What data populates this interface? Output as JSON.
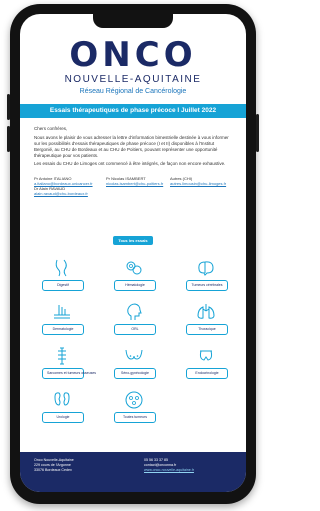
{
  "logo": {
    "word": "ONCO",
    "region": "NOUVELLE-AQUITAINE",
    "subtitle": "Réseau Régional de Cancérologie"
  },
  "banner": {
    "title": "Essais thérapeutiques de phase précoce I Juillet 2022"
  },
  "body": {
    "greeting": "Chers confrères,",
    "intro": "Nous avons le plaisir de vous adresser la lettre d'information bimestrielle destinée à vous informer sur les possibilités d'essais thérapeutiques de phase précoce (I et II) disponibles à l'Institut Bergonié, au CHU de Bordeaux et au CHU de Poitiers, pouvant représenter une opportunité thérapeutique pour vos patients.",
    "note": "Les essais du CHU de Limoges ont commencé à être intégrés, de façon non encore exhaustive."
  },
  "contacts": [
    {
      "name": "Pr Antoine ITALIANO",
      "link": "a.italiano@bordeaux.unicancer.fr",
      "name2": "Dr Alain RAVAUD",
      "link2": "alain.ravaud@chu-bordeaux.fr"
    },
    {
      "name": "Pr Nicolas ISAMBERT",
      "link": "nicolas.isambert@chu-poitiers.fr"
    },
    {
      "name": "Autres (CHI)",
      "link": "autres.limousin@chu-limoges.fr"
    }
  ],
  "cta": {
    "label": "Tous les essais"
  },
  "tiles": [
    {
      "label": "Digestif",
      "icon": "digestive-icon"
    },
    {
      "label": "Hématologie",
      "icon": "blood-cells-icon"
    },
    {
      "label": "Tumeurs cérébrales",
      "icon": "brain-icon"
    },
    {
      "label": "Dermatologie",
      "icon": "skin-icon"
    },
    {
      "label": "ORL",
      "icon": "head-profile-icon"
    },
    {
      "label": "Thoracique",
      "icon": "lungs-icon"
    },
    {
      "label": "Sarcomes et tumeurs osseuses",
      "icon": "bone-icon"
    },
    {
      "label": "Séno-gynécologie",
      "icon": "breast-icon"
    },
    {
      "label": "Endocrinologie",
      "icon": "thyroid-icon"
    },
    {
      "label": "Urologie",
      "icon": "kidney-icon"
    },
    {
      "label": "Toutes tumeurs",
      "icon": "all-tumors-icon"
    }
  ],
  "footer": {
    "org": "Onco Nouvelle-Aquitaine",
    "address1": "229 cours de l'Argonne",
    "address2": "33076 Bordeaux Cedex",
    "phone": "05 56 33 37 85",
    "email": "contact@onconna.fr",
    "website": "www.onco-nouvelle-aquitaine.fr"
  },
  "colors": {
    "navy": "#1b2a66",
    "accent": "#16a3d6"
  }
}
